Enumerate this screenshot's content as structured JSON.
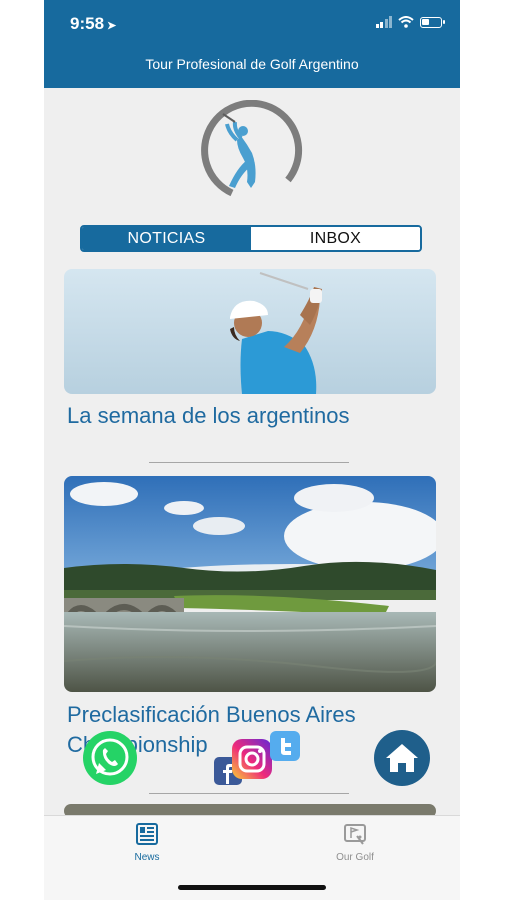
{
  "status_bar": {
    "time": "9:58",
    "location_icon": "location-arrow-icon"
  },
  "header": {
    "title": "Tour Profesional de Golf Argentino"
  },
  "segmented": {
    "tabs": [
      {
        "label": "NOTICIAS",
        "active": true
      },
      {
        "label": "INBOX",
        "active": false
      }
    ]
  },
  "news": [
    {
      "title": "La semana de los argentinos"
    },
    {
      "title_line1": "Preclasificación Buenos Aires",
      "title_line2": "Championship"
    }
  ],
  "floating": {
    "icons": [
      "whatsapp-icon",
      "facebook-icon",
      "instagram-icon",
      "twitter-icon",
      "home-icon"
    ]
  },
  "tabbar": {
    "items": [
      {
        "label": "News",
        "active": true
      },
      {
        "label": "Our Golf",
        "active": false
      }
    ]
  },
  "colors": {
    "brand": "#176a9e",
    "link": "#1f6aa0",
    "whatsapp": "#25d366",
    "facebook": "#3b5998",
    "twitter": "#55acee",
    "home_button": "#1f5f8b"
  }
}
